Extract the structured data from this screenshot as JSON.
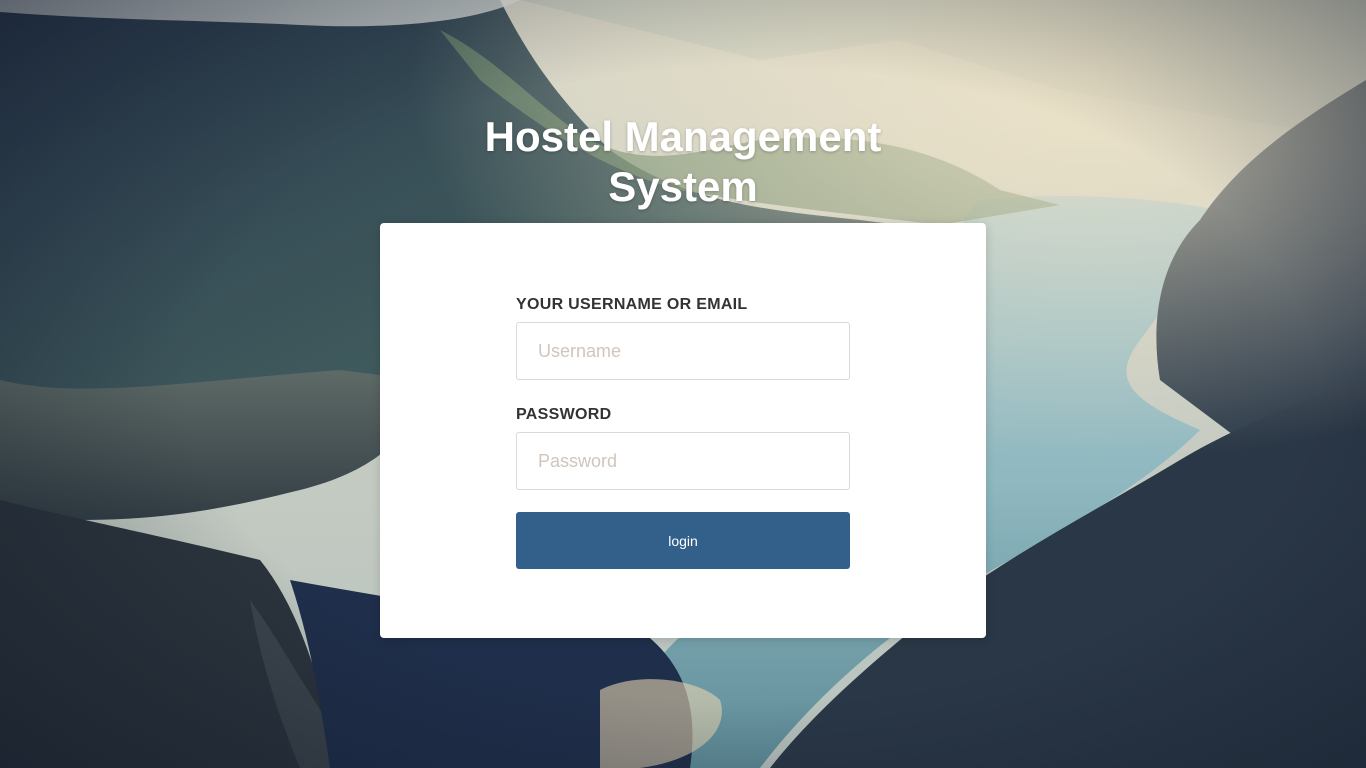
{
  "page": {
    "title": "Hostel Management System"
  },
  "login_form": {
    "username_label": "YOUR USERNAME OR EMAIL",
    "username_placeholder": "Username",
    "username_value": "",
    "password_label": "PASSWORD",
    "password_placeholder": "Password",
    "password_value": "",
    "login_button_label": "login"
  },
  "colors": {
    "button": "#33608b",
    "card": "#ffffff",
    "label_text": "#333333",
    "placeholder_text": "#cfc6bc",
    "title_text": "#ffffff"
  }
}
